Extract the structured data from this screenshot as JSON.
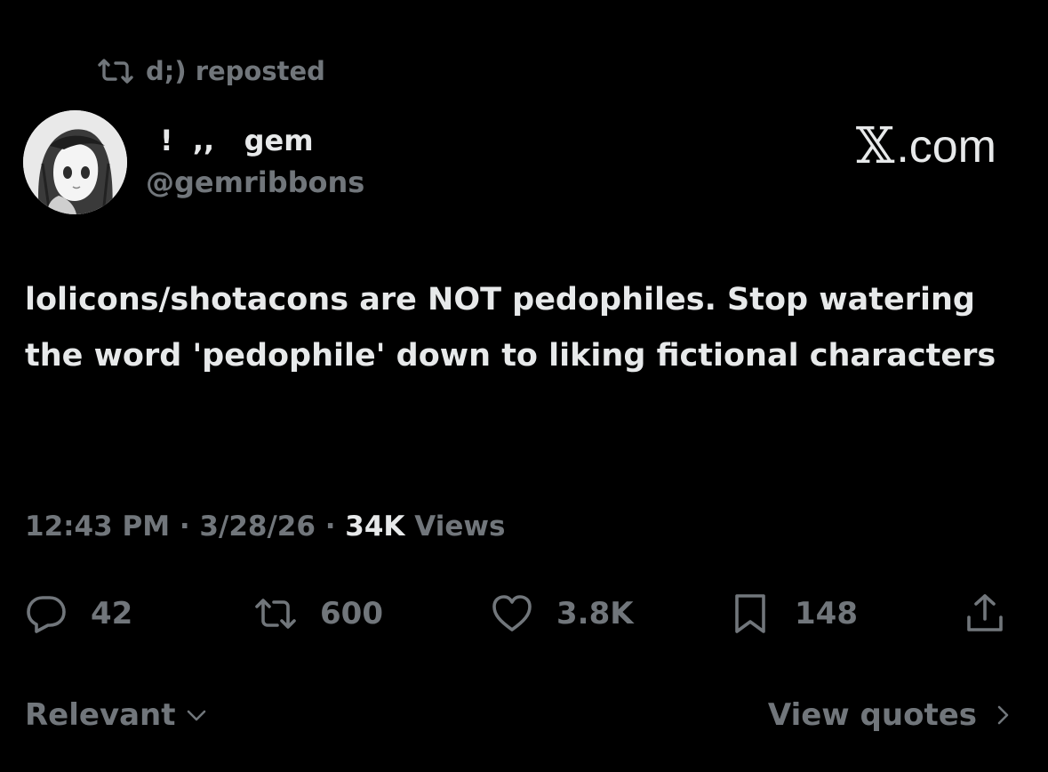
{
  "repost": {
    "icon": "repost-icon",
    "label": "d;) reposted"
  },
  "author": {
    "avatar": "avatar-image",
    "display_name": "!  ,,   gem",
    "handle": "@gemribbons"
  },
  "brand": {
    "x_mark": "𝕏",
    "domain": ".com"
  },
  "tweet": {
    "text": "lolicons/shotacons are NOT pedophiles. Stop watering the word 'pedophile' down to liking fictional characters"
  },
  "meta": {
    "time": "12:43 PM",
    "sep1": " · ",
    "date": "3/28/26",
    "sep2": " · ",
    "views_count": "34K",
    "views_label": " Views"
  },
  "actions": {
    "reply": {
      "icon": "reply-icon",
      "count": "42"
    },
    "repost": {
      "icon": "repost-icon",
      "count": "600"
    },
    "like": {
      "icon": "heart-icon",
      "count": "3.8K"
    },
    "bookmark": {
      "icon": "bookmark-icon",
      "count": "148"
    },
    "share": {
      "icon": "share-icon"
    }
  },
  "footer": {
    "sort_label": "Relevant",
    "sort_icon": "chevron-down-icon",
    "quotes_label": "View quotes",
    "quotes_icon": "chevron-right-icon"
  },
  "colors": {
    "background": "#000000",
    "text": "#e7e9ea",
    "muted": "#71767b"
  }
}
